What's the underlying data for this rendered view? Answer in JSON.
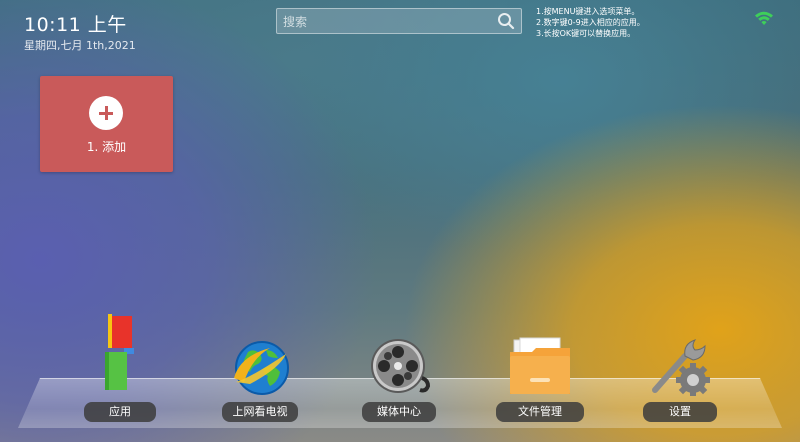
{
  "status": {
    "time": "10:11 上午",
    "date": "星期四,七月 1th,2021"
  },
  "search": {
    "placeholder": "搜索",
    "value": ""
  },
  "hints": [
    "1.按MENU键进入选项菜单。",
    "2.数字键0-9进入相应的应用。",
    "3.长按OK键可以替换应用。"
  ],
  "add_tile": {
    "label": "1. 添加",
    "color": "#c95a5a"
  },
  "dock": [
    {
      "label": "应用",
      "icon": "apps-icon"
    },
    {
      "label": "上网看电视",
      "icon": "globe-icon"
    },
    {
      "label": "媒体中心",
      "icon": "film-reel-icon"
    },
    {
      "label": "文件管理",
      "icon": "folder-icon"
    },
    {
      "label": "设置",
      "icon": "settings-gear-icon"
    }
  ],
  "colors": {
    "wifi": "#3ecf5a",
    "folder": "#f5a33a"
  }
}
